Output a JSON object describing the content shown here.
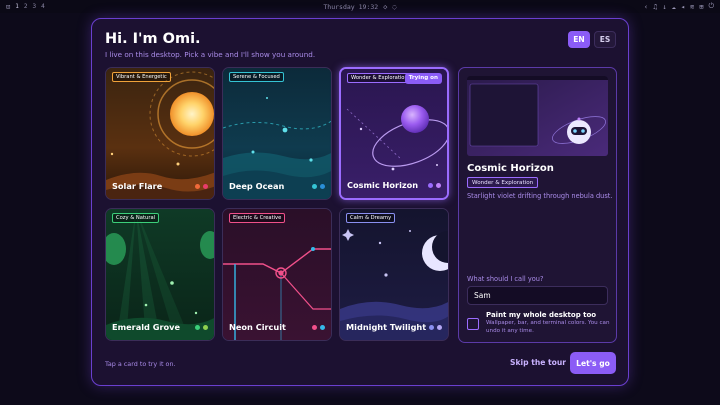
{
  "topbar": {
    "workspaces": [
      "1",
      "2",
      "3",
      "4"
    ],
    "clock": "Thursday 19:32"
  },
  "dialog": {
    "title": "Hi. I'm Omi.",
    "subtitle": "I live on this desktop. Pick a vibe and I'll show you around.",
    "lang_en": "EN",
    "lang_es": "ES",
    "hint": "Tap a card to try it on.",
    "skip_label": "Skip the tour",
    "go_label": "Let's go"
  },
  "cards": [
    {
      "tag": "Vibrant & Energetic",
      "name": "Solar Flare",
      "tag_color": "#f0a23a",
      "dots": [
        "#f06a3a",
        "#e93c6a"
      ]
    },
    {
      "tag": "Serene & Focused",
      "name": "Deep Ocean",
      "tag_color": "#35c4d4",
      "dots": [
        "#35c4d4",
        "#2a8fd8"
      ]
    },
    {
      "tag": "Wonder & Exploration",
      "name": "Cosmic Horizon",
      "tag_color": "#9b6cff",
      "dots": [
        "#9b6cff",
        "#c084fc"
      ],
      "badge": "Trying on"
    },
    {
      "tag": "Cozy & Natural",
      "name": "Emerald Grove",
      "tag_color": "#3ccf7a",
      "dots": [
        "#3ccf7a",
        "#8fd14f"
      ]
    },
    {
      "tag": "Electric & Creative",
      "name": "Neon Circuit",
      "tag_color": "#f0508a",
      "dots": [
        "#f0508a",
        "#35b8e8"
      ]
    },
    {
      "tag": "Calm & Dreamy",
      "name": "Midnight Twilight",
      "tag_color": "#8a8ff0",
      "dots": [
        "#8a8ff0",
        "#b5a8f5"
      ]
    }
  ],
  "preview": {
    "title": "Cosmic Horizon",
    "tag": "Wonder & Exploration",
    "description": "Starlight violet drifting through nebula dust.",
    "name_label": "What should I call you?",
    "name_value": "Sam",
    "paint_label": "Paint my whole desktop too",
    "paint_desc": "Wallpaper, bar, and terminal colors. You can undo it any time."
  }
}
